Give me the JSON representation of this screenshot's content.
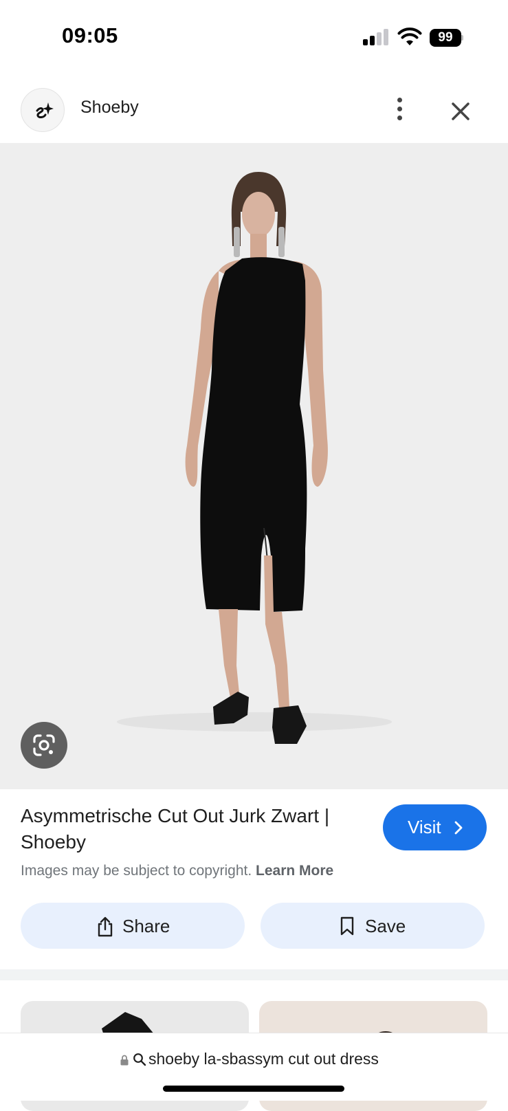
{
  "status_bar": {
    "time": "09:05",
    "battery_level": "99",
    "signal_bars": 2,
    "icons": [
      "cellular-signal-icon",
      "wifi-icon",
      "battery-icon"
    ]
  },
  "header": {
    "site_name": "Shoeby",
    "icons": [
      "shoeby-logo-icon",
      "more-vert-icon",
      "close-icon"
    ]
  },
  "image": {
    "description_icon": "google-lens-icon"
  },
  "result": {
    "title": "Asymmetrische Cut Out Jurk Zwart | Shoeby",
    "visit_label": "Visit",
    "copyright_text": "Images may be subject to copyright.",
    "learn_more_label": "Learn More",
    "share_label": "Share",
    "save_label": "Save"
  },
  "address_bar": {
    "query": "shoeby la-sbassym cut out dress"
  },
  "colors": {
    "accent": "#1a73e8",
    "pill_background": "#e8f0fd",
    "image_background": "#eeeeee"
  }
}
